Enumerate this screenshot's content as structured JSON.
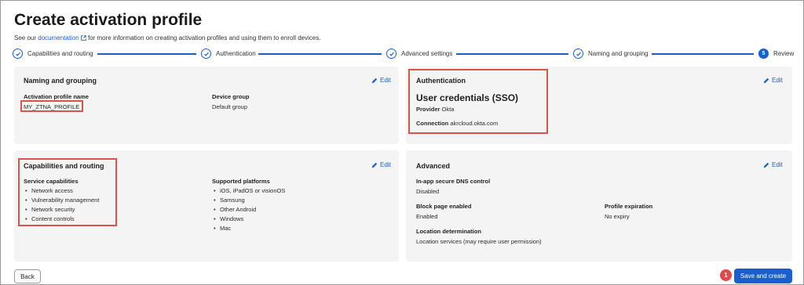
{
  "page": {
    "title": "Create activation profile",
    "subtitle_prefix": "See our ",
    "subtitle_link": "documentation",
    "subtitle_suffix": " for more information on creating activation profiles and using them to enroll devices."
  },
  "stepper": {
    "steps": [
      {
        "label": "Capabilities and routing",
        "state": "done"
      },
      {
        "label": "Authentication",
        "state": "done"
      },
      {
        "label": "Advanced settings",
        "state": "done"
      },
      {
        "label": "Naming and grouping",
        "state": "done"
      },
      {
        "label": "Review",
        "state": "current",
        "number": "5"
      }
    ]
  },
  "naming": {
    "title": "Naming and grouping",
    "edit": "Edit",
    "profile_name_label": "Activation profile name",
    "profile_name_value": "MY_ZTNA_PROFILE",
    "device_group_label": "Device group",
    "device_group_value": "Default group"
  },
  "authentication": {
    "title": "Authentication",
    "edit": "Edit",
    "method": "User credentials (SSO)",
    "provider_label": "Provider",
    "provider_value": "Okta",
    "connection_label": "Connection",
    "connection_value": "akrcloud.okta.com"
  },
  "capabilities": {
    "title": "Capabilities and routing",
    "edit": "Edit",
    "service_label": "Service capabilities",
    "services": [
      "Network access",
      "Vulnerability management",
      "Network security",
      "Content controls"
    ],
    "platforms_label": "Supported platforms",
    "platforms": [
      "iOS, iPadOS or visionOS",
      "Samsung",
      "Other Android",
      "Windows",
      "Mac"
    ]
  },
  "advanced": {
    "title": "Advanced",
    "edit": "Edit",
    "dns_label": "In-app secure DNS control",
    "dns_value": "Disabled",
    "block_label": "Block page enabled",
    "block_value": "Enabled",
    "expiration_label": "Profile expiration",
    "expiration_value": "No expiry",
    "location_label": "Location determination",
    "location_value": "Location services (may require user permission)"
  },
  "footer": {
    "back": "Back",
    "badge": "1",
    "save": "Save and create"
  },
  "colors": {
    "accent": "#1a5fd0",
    "highlight": "#d9534f",
    "card_bg": "#f4f4f4"
  }
}
